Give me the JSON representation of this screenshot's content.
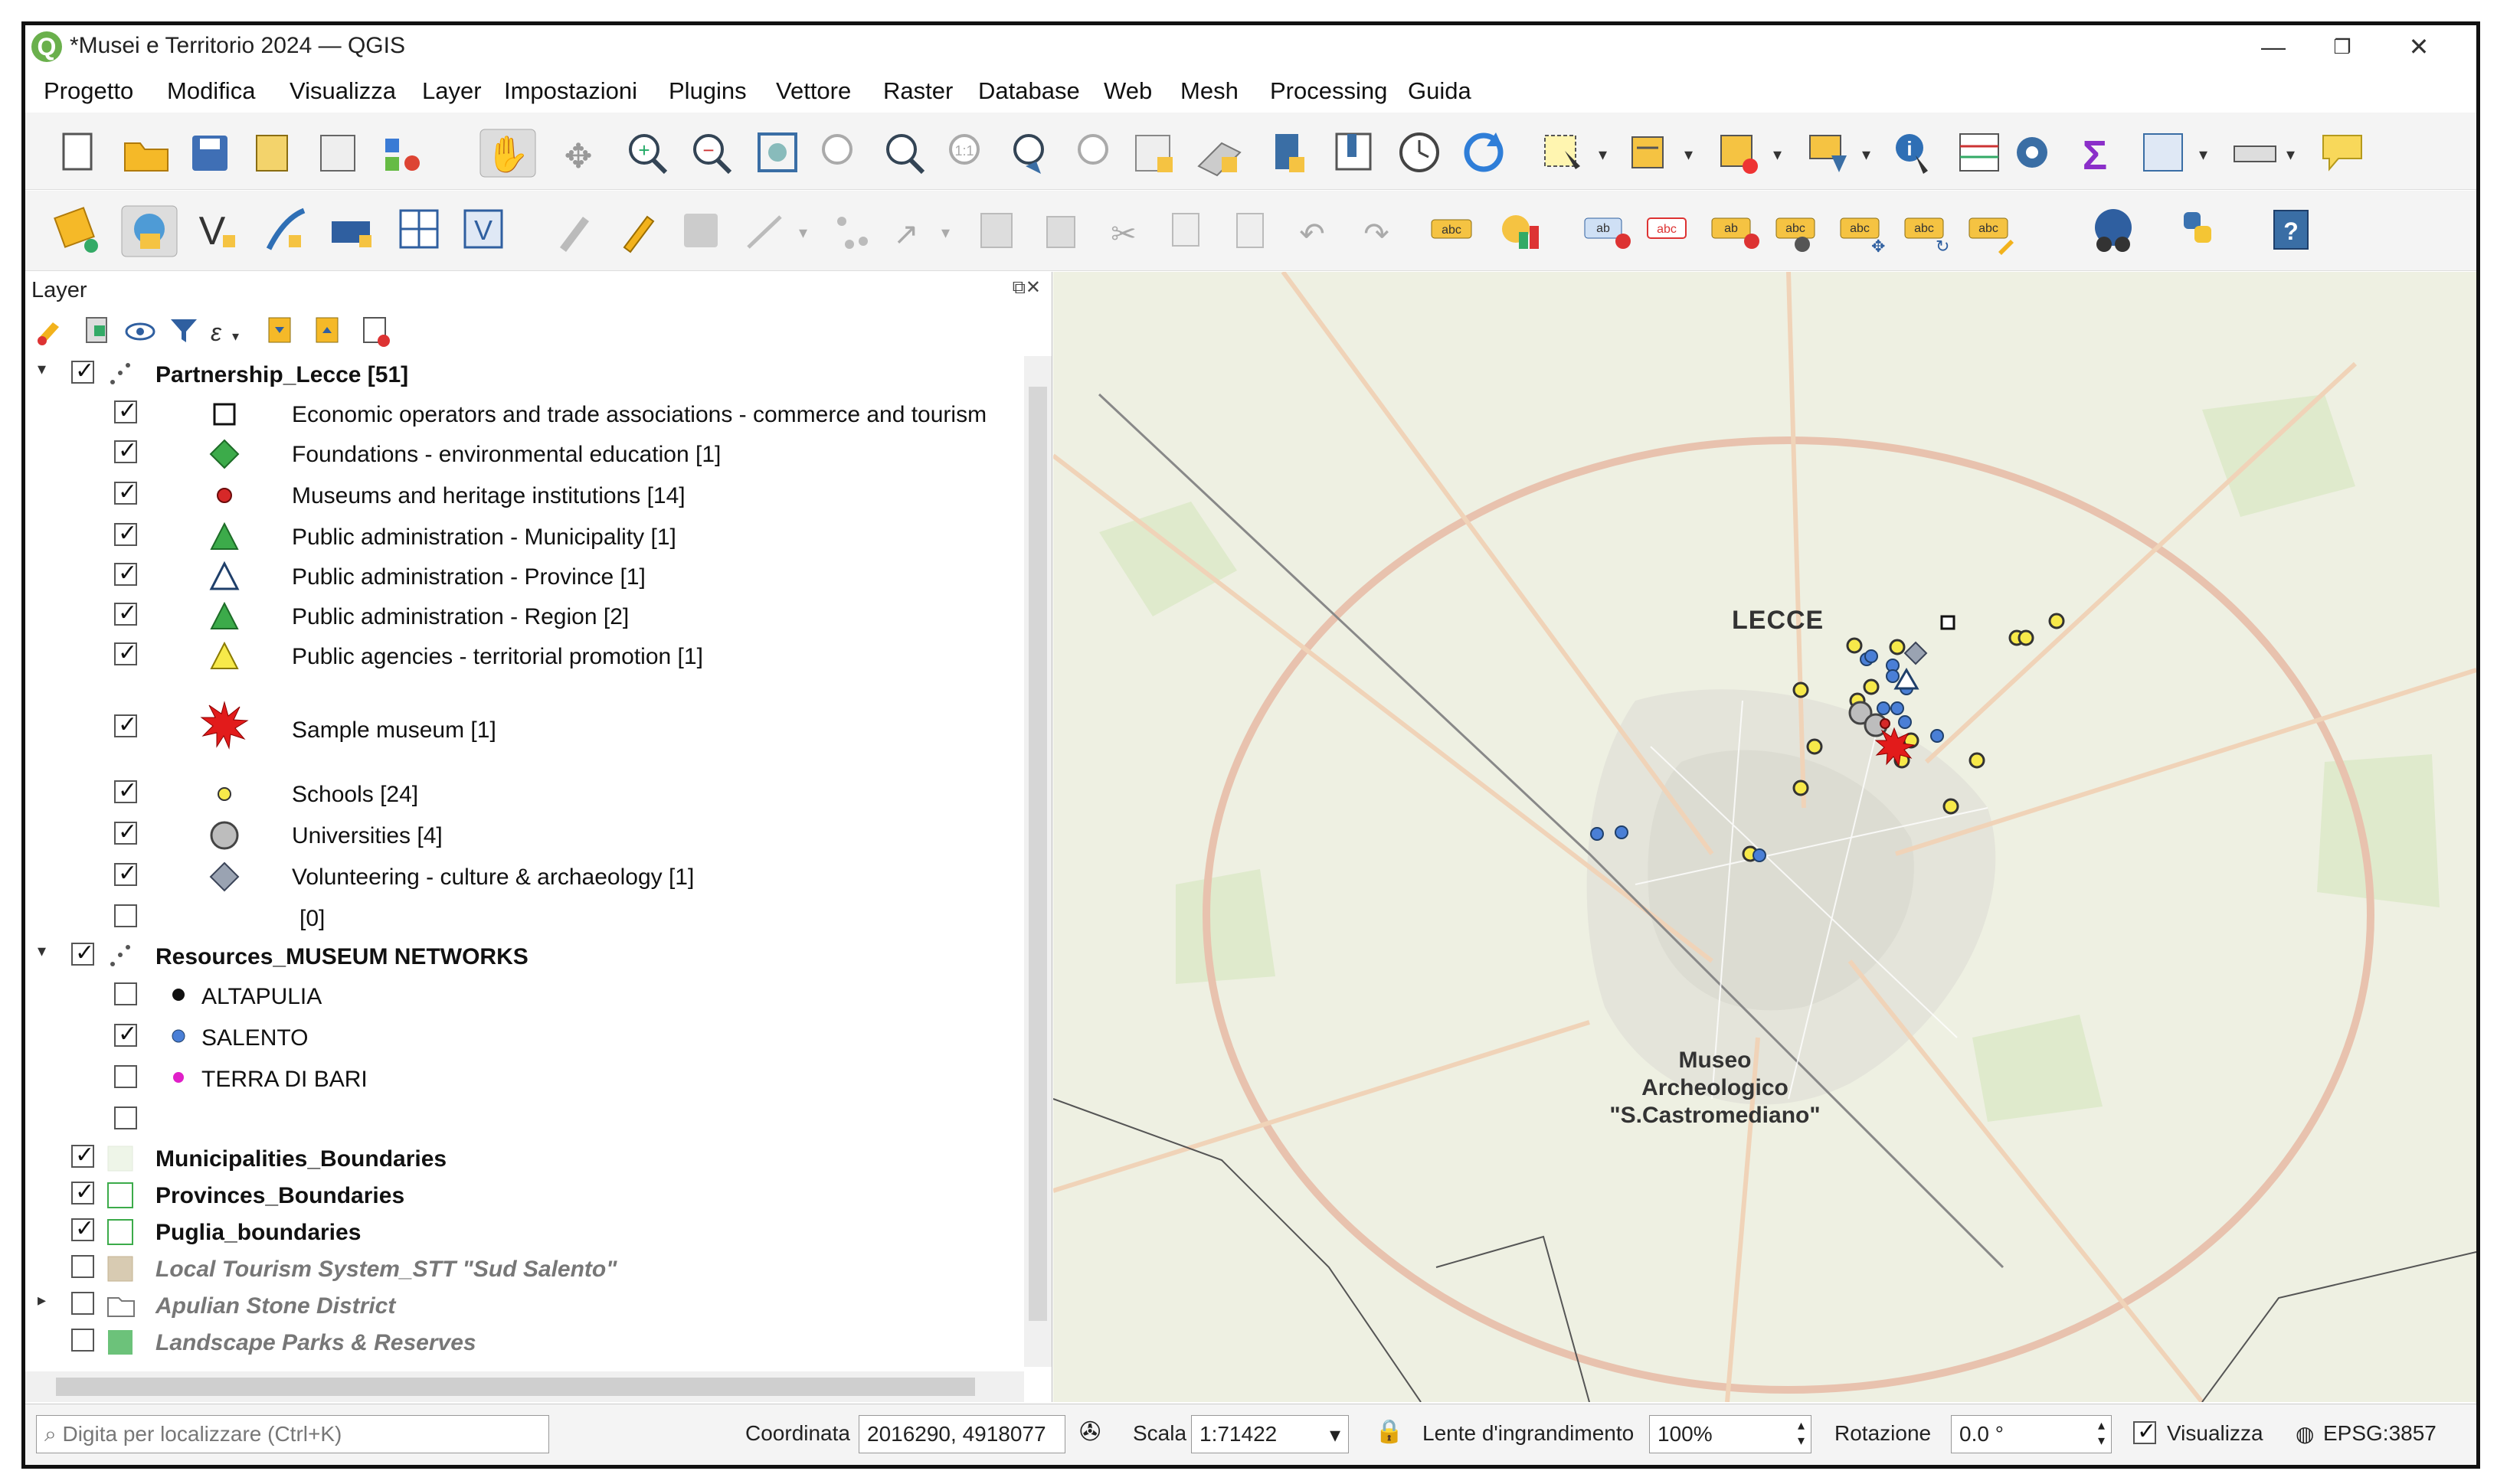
{
  "window": {
    "title": "*Musei e Territorio 2024 — QGIS"
  },
  "menu": [
    "Progetto",
    "Modifica",
    "Visualizza",
    "Layer",
    "Impostazioni",
    "Plugins",
    "Vettore",
    "Raster",
    "Database",
    "Web",
    "Mesh",
    "Processing",
    "Guida"
  ],
  "layer_panel": {
    "title": "Layer",
    "tree": [
      {
        "label": "Partnership_Lecce [51]",
        "bold": true,
        "checked": true,
        "expanded": true
      },
      {
        "label": "Economic operators and trade associations - commerce and tourism",
        "checked": true,
        "symbol": "square-outline"
      },
      {
        "label": "Foundations - environmental education [1]",
        "checked": true,
        "symbol": "diamond-green"
      },
      {
        "label": "Museums and heritage institutions [14]",
        "checked": true,
        "symbol": "dot-red"
      },
      {
        "label": "Public administration - Municipality [1]",
        "checked": true,
        "symbol": "triangle-green"
      },
      {
        "label": "Public administration - Province [1]",
        "checked": true,
        "symbol": "triangle-outline"
      },
      {
        "label": "Public administration - Region [2]",
        "checked": true,
        "symbol": "triangle-green"
      },
      {
        "label": "Public agencies - territorial promotion [1]",
        "checked": true,
        "symbol": "triangle-yellow"
      },
      {
        "label": "Sample museum [1]",
        "checked": true,
        "symbol": "star-red"
      },
      {
        "label": "Schools [24]",
        "checked": true,
        "symbol": "dot-yellow"
      },
      {
        "label": "Universities [4]",
        "checked": true,
        "symbol": "circle-grey"
      },
      {
        "label": "Volunteering - culture & archaeology [1]",
        "checked": true,
        "symbol": "diamond-grey"
      },
      {
        "label": "[0]",
        "checked": false,
        "symbol": "none"
      },
      {
        "label": "Resources_MUSEUM NETWORKS",
        "bold": true,
        "checked": true,
        "expanded": true
      },
      {
        "label": "ALTAPULIA",
        "checked": false,
        "symbol": "dot-black"
      },
      {
        "label": "SALENTO",
        "checked": true,
        "symbol": "dot-blue"
      },
      {
        "label": "TERRA DI BARI",
        "checked": false,
        "symbol": "dot-magenta"
      },
      {
        "label": "",
        "checked": false,
        "symbol": "none"
      },
      {
        "label": "Municipalities_Boundaries",
        "bold": true,
        "checked": true,
        "symbol": "fill-palegreen"
      },
      {
        "label": "Provinces_Boundaries",
        "bold": true,
        "checked": true,
        "symbol": "fill-outline-green"
      },
      {
        "label": "Puglia_boundaries",
        "bold": true,
        "checked": true,
        "symbol": "fill-outline-green"
      },
      {
        "label": "Local Tourism System_STT \"Sud Salento\"",
        "italic": true,
        "checked": false,
        "symbol": "fill-tan"
      },
      {
        "label": "Apulian Stone District",
        "italic": true,
        "checked": false,
        "symbol": "group-outline",
        "collapsed": true
      },
      {
        "label": "Landscape Parks & Reserves",
        "italic": true,
        "checked": false,
        "symbol": "fill-green"
      }
    ]
  },
  "map": {
    "city_label": "LECCE",
    "museum_label": [
      "Museo",
      "Archeologico",
      "\"S.Castromediano\""
    ]
  },
  "status": {
    "search_placeholder": "Digita per localizzare (Ctrl+K)",
    "coord_label": "Coordinata",
    "coord_value": "2016290, 4918077",
    "scale_label": "Scala",
    "scale_value": "1:71422",
    "magnifier_label": "Lente d'ingrandimento",
    "magnifier_value": "100%",
    "rotation_label": "Rotazione",
    "rotation_value": "0.0 °",
    "render_label": "Visualizza",
    "crs": "EPSG:3857"
  },
  "colors": {
    "qgis_green": "#6ab04c",
    "school_yellow": "#f2e34a",
    "salento_blue": "#4a7fd6",
    "museum_red": "#d62828",
    "map_bg": "#eef0e2",
    "ring_road": "#e4b8a3"
  }
}
